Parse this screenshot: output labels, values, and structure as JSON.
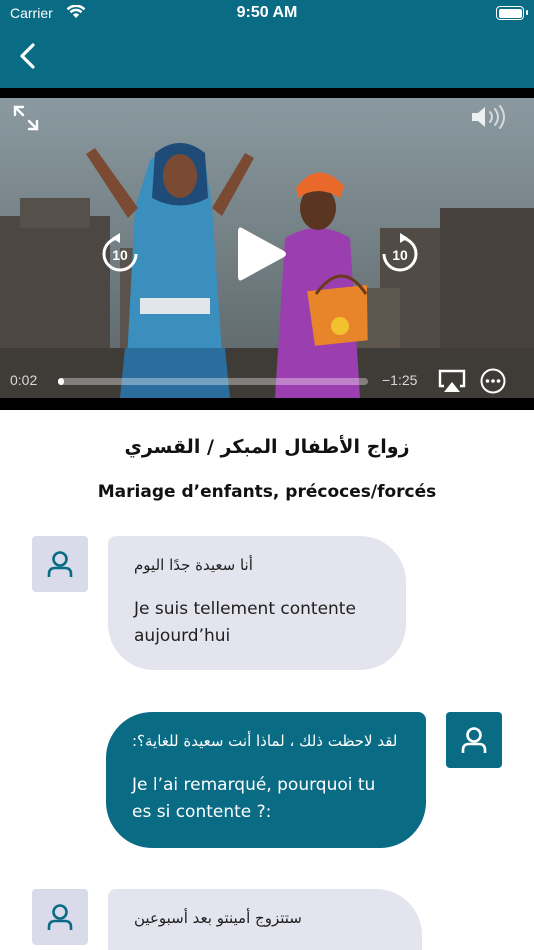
{
  "status_bar": {
    "carrier": "Carrier",
    "time": "9:50 AM",
    "icons": [
      "wifi-icon",
      "battery-icon"
    ]
  },
  "nav": {
    "back_icon": "chevron-left-icon",
    "bar_color": "#0a6b84"
  },
  "video": {
    "current_time": "0:02",
    "remaining_time": "−1:25",
    "progress_fraction": 0.02,
    "skip_seconds_label": "10",
    "icons": [
      "expand-icon",
      "volume-icon",
      "skip-back-10-icon",
      "play-icon",
      "skip-forward-10-icon",
      "airplay-icon",
      "more-icon"
    ]
  },
  "titles": {
    "arabic": "زواج الأطفال المبكر / القسري",
    "french": "Mariage d’enfants, précoces/forcés"
  },
  "messages": [
    {
      "side": "left",
      "arabic": "أنا سعيدة جدًا اليوم",
      "french": "Je suis tellement contente aujourd’hui"
    },
    {
      "side": "right",
      "arabic": "لقد لاحظت ذلك ، لماذا أنت سعيدة للغاية؟:",
      "french": "Je l’ai remarqué, pourquoi tu es si contente ?:"
    },
    {
      "side": "left",
      "arabic": "ستتزوج أمينتو بعد أسبوعين",
      "french": ""
    }
  ],
  "colors": {
    "teal": "#0a6b84",
    "bubble_light": "#e3e4ee",
    "avatar_light": "#d9dbea"
  }
}
